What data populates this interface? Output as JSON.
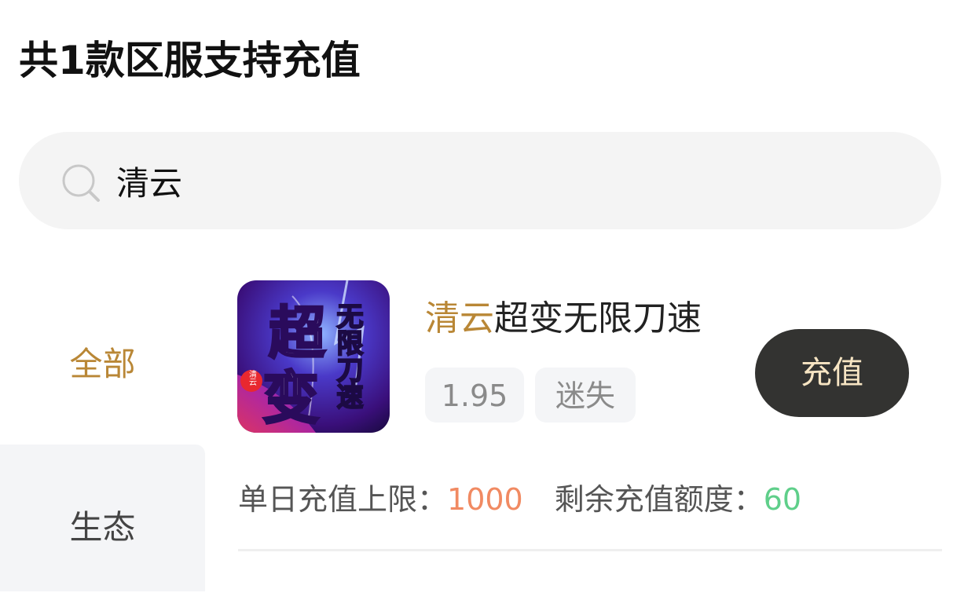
{
  "header": {
    "title": "共1款区服支持充值"
  },
  "search": {
    "value": "清云",
    "icon": "search-icon"
  },
  "sidebar": {
    "items": [
      {
        "label": "全部",
        "active": true
      },
      {
        "label": "生态",
        "active": false
      }
    ]
  },
  "game": {
    "name_highlight": "清云",
    "name_rest": "超变无限刀速",
    "icon_text": {
      "big1": "超",
      "big2": "变",
      "small": "无限刀速",
      "badge": "清云"
    },
    "tags": [
      "1.95",
      "迷失"
    ],
    "button_label": "充值",
    "daily_limit_label": "单日充值上限：",
    "daily_limit_value": "1000",
    "remaining_label": "剩余充值额度：",
    "remaining_value": "60"
  },
  "colors": {
    "accent": "#b98736",
    "button_bg": "#333331",
    "button_text": "#f7e5c3",
    "limit_value": "#f18a62",
    "remaining_value": "#5fcf8a"
  }
}
